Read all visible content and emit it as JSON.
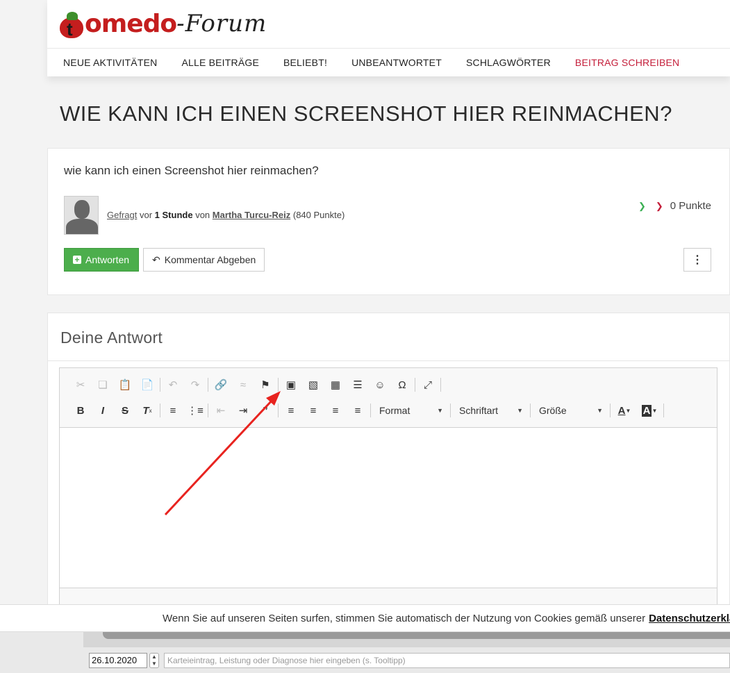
{
  "logo": {
    "first_letter": "t",
    "word1": "omedo",
    "word2": "-Forum"
  },
  "nav": {
    "items": [
      "NEUE AKTIVITÄTEN",
      "ALLE BEITRÄGE",
      "BELIEBT!",
      "UNBEANTWORTET",
      "SCHLAGWÖRTER"
    ],
    "write": "BEITRAG SCHREIBEN"
  },
  "page": {
    "title": "WIE KANN ICH EINEN SCREENSHOT HIER REINMACHEN?"
  },
  "question": {
    "text": "wie kann ich einen Screenshot hier reinmachen?",
    "asked_label": "Gefragt",
    "ago_prefix": "vor",
    "ago": "1 Stunde",
    "by_label": "von",
    "author": "Martha Turcu-Reiz",
    "author_points": "(840 Punkte)",
    "votes": "0 Punkte",
    "answer_button": "Antworten",
    "comment_button": "Kommentar Abgeben"
  },
  "answer": {
    "title": "Deine Antwort",
    "combos": {
      "format": "Format",
      "font": "Schriftart",
      "size": "Größe"
    }
  },
  "cookie": {
    "text": "Wenn Sie auf unseren Seiten surfen, stimmen Sie automatisch der Nutzung von Cookies gemäß unserer",
    "link": "Datenschutzerklärung"
  },
  "bottom": {
    "date": "26.10.2020",
    "entry_placeholder": "Karteieintrag, Leistung oder Diagnose hier eingeben (s. Tooltipp)"
  },
  "colors": {
    "accent": "#c41e3a",
    "answer_button": "#4cae4c",
    "arrow": "#e8231f"
  }
}
